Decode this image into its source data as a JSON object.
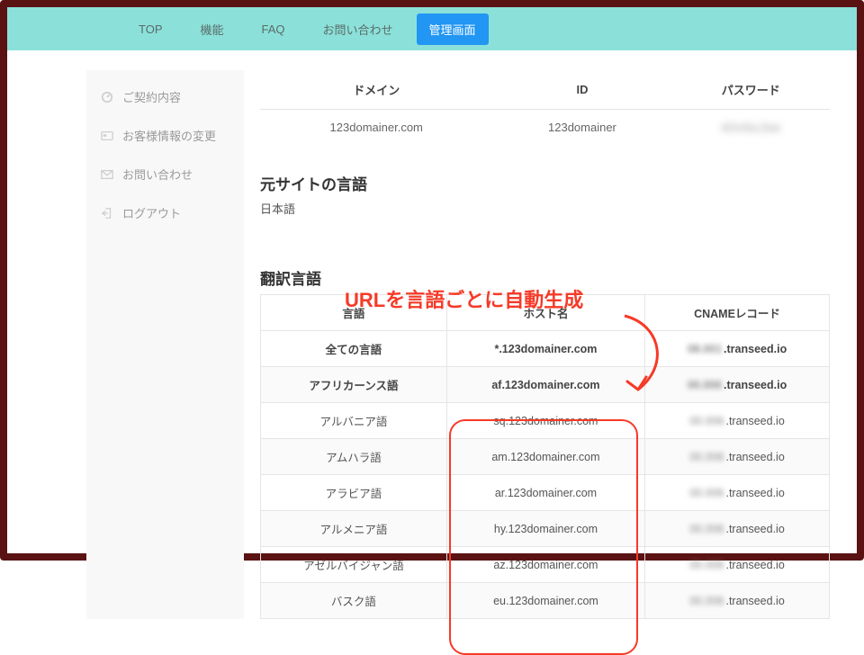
{
  "nav": {
    "top": "TOP",
    "features": "機能",
    "faq": "FAQ",
    "contact": "お問い合わせ",
    "admin": "管理画面"
  },
  "sidebar": {
    "items": [
      {
        "label": "ご契約内容"
      },
      {
        "label": "お客様情報の変更"
      },
      {
        "label": "お問い合わせ"
      },
      {
        "label": "ログアウト"
      }
    ]
  },
  "info": {
    "headers": {
      "domain": "ドメイン",
      "id": "ID",
      "password": "パスワード"
    },
    "row": {
      "domain": "123domainer.com",
      "id": "123domainer",
      "password": "iiOv3xL2ea"
    }
  },
  "source_lang_section": {
    "title": "元サイトの言語",
    "value": "日本語"
  },
  "callout_text": "URLを言語ごとに自動生成",
  "translate_section": {
    "title": "翻訳言語",
    "headers": {
      "lang": "言語",
      "host": "ホスト名",
      "cname": "CNAMEレコード"
    },
    "all_row": {
      "lang": "全ての言語",
      "host": "*.123domainer.com",
      "cname_blur": "08.001",
      "cname_tail": ".transeed.io"
    },
    "rows": [
      {
        "lang": "アフリカーンス語",
        "host": "af.123domainer.com",
        "cname_blur": "00.006",
        "cname_tail": ".transeed.io"
      },
      {
        "lang": "アルバニア語",
        "host": "sq.123domainer.com",
        "cname_blur": "00.006",
        "cname_tail": ".transeed.io"
      },
      {
        "lang": "アムハラ語",
        "host": "am.123domainer.com",
        "cname_blur": "00.006",
        "cname_tail": ".transeed.io"
      },
      {
        "lang": "アラビア語",
        "host": "ar.123domainer.com",
        "cname_blur": "00.006",
        "cname_tail": ".transeed.io"
      },
      {
        "lang": "アルメニア語",
        "host": "hy.123domainer.com",
        "cname_blur": "00.006",
        "cname_tail": ".transeed.io"
      },
      {
        "lang": "アゼルバイジャン語",
        "host": "az.123domainer.com",
        "cname_blur": "00.006",
        "cname_tail": ".transeed.io"
      },
      {
        "lang": "バスク語",
        "host": "eu.123domainer.com",
        "cname_blur": "00.006",
        "cname_tail": ".transeed.io"
      }
    ]
  }
}
